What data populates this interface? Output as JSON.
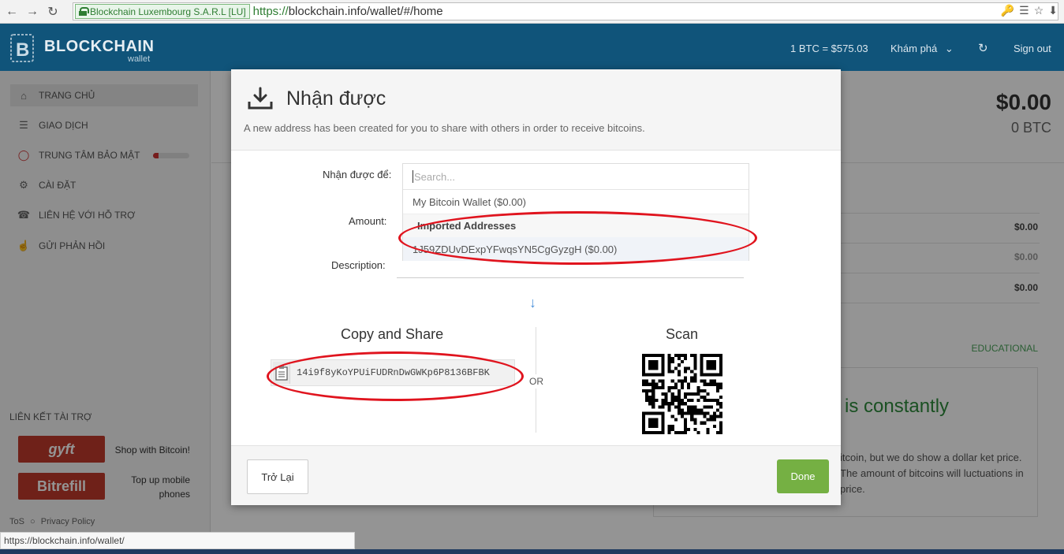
{
  "browser": {
    "ev_label": "Blockchain Luxembourg S.A.R.L [LU]",
    "url_scheme": "https://",
    "url_rest": "blockchain.info/wallet/#/home",
    "status_url": "https://blockchain.info/wallet/"
  },
  "header": {
    "brand": "BLOCKCHAIN",
    "brand_sub": "wallet",
    "rate": "1 BTC = $575.03",
    "explore": "Khám phá",
    "sign_out": "Sign out"
  },
  "sidebar": {
    "items": [
      {
        "label": "TRANG CHỦ",
        "icon": "home-icon"
      },
      {
        "label": "GIAO DỊCH",
        "icon": "list-icon"
      },
      {
        "label": "TRUNG TÂM BẢO MẬT",
        "icon": "lock-icon"
      },
      {
        "label": "CÀI ĐẶT",
        "icon": "gear-icon"
      },
      {
        "label": "LIÊN HỆ VỚI HỖ TRỢ",
        "icon": "headset-icon"
      },
      {
        "label": "GỬI PHẢN HỒI",
        "icon": "thumbs-up-icon"
      }
    ],
    "security_level": 0.15,
    "sponsor_title": "LIÊN KẾT TÀI TRỢ",
    "sponsors": [
      {
        "logo": "gyft",
        "text": "Shop with Bitcoin!"
      },
      {
        "logo": "Bitrefill",
        "text": "Top up mobile phones"
      }
    ],
    "tos": "ToS",
    "privacy": "Privacy Policy"
  },
  "main": {
    "balance_usd": "$0.00",
    "balance_btc": "0 BTC",
    "rows": [
      "$0.00",
      "$0.00",
      "$0.00"
    ],
    "educational": "EDUCATIONAL",
    "edu_big": "is constantly",
    "edu_small": "itcoin, but we do show a dollar ket price. The amount of bitcoins will luctuations in price."
  },
  "modal": {
    "title": "Nhận được",
    "description": "A new address has been created for you to share with others in order to receive bitcoins.",
    "receive_to_label": "Nhận được để:",
    "amount_label": "Amount:",
    "description_label": "Description:",
    "search_placeholder": "Search...",
    "wallet_option": "My Bitcoin Wallet  ($0.00)",
    "imported_group": "Imported Addresses",
    "imported_option": "1J59ZDUvDExpYFwqsYN5CgGyzgH  ($0.00)",
    "copy_title": "Copy and Share",
    "address": "14i9f8yKoYPUiFUDRnDwGWKp6P8136BFBK",
    "or": "OR",
    "scan_title": "Scan",
    "back_button": "Trở Lại",
    "done_button": "Done"
  },
  "colors": {
    "header_bg": "#10547a",
    "done_green": "#75b043",
    "annotation_red": "#e0141e"
  }
}
